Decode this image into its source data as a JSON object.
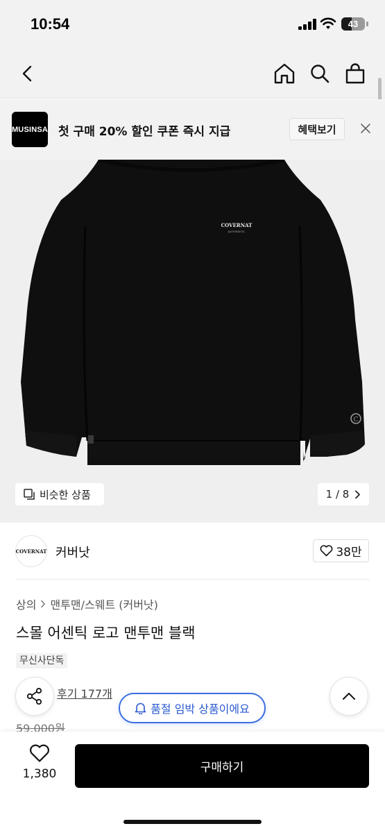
{
  "status_bar": {
    "time": "10:54",
    "battery": "43",
    "battery_level": 0.43
  },
  "nav": {
    "back_icon": "chevron-left-icon",
    "home_icon": "home-icon",
    "search_icon": "search-icon",
    "cart_icon": "shopping-bag-icon"
  },
  "promo": {
    "logo_text": "MUSINSA",
    "text": "첫 구매 20% 할인 쿠폰 즉시 지급",
    "button_label": "혜택보기"
  },
  "product_image": {
    "print_text_line1": "COVERNAT",
    "print_text_line2": "AUTHENTIC",
    "cuff_mark": "C",
    "similar_label": "비슷한 상품",
    "page_counter": "1 / 8"
  },
  "brand": {
    "logo_text": "COVERNAT",
    "name": "커버낫",
    "likes": "38만"
  },
  "product": {
    "breadcrumb": [
      "상의",
      "맨투맨/스웨트 (커버낫)"
    ],
    "title": "스몰 어센틱 로고 맨투맨 블랙",
    "badge": "무신사단독",
    "reviews": "후기 177개",
    "price": "59,000원"
  },
  "floating": {
    "stock_alert": "품절 임박 상품이에요"
  },
  "bottom_bar": {
    "wish_count": "1,380",
    "buy_label": "구매하기"
  },
  "colors": {
    "accent_blue": "#3b6fe0",
    "buy_button": "#000000"
  }
}
